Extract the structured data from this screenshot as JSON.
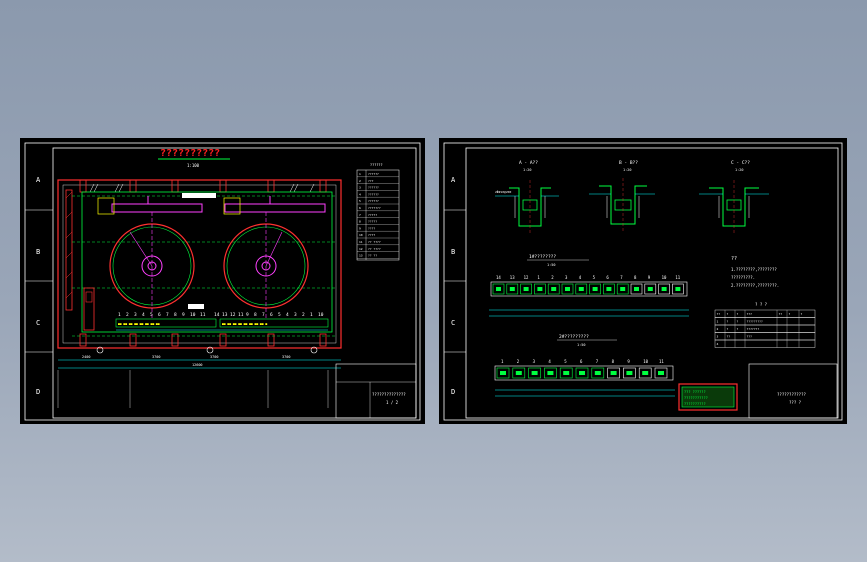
{
  "colors": {
    "background_top": "#8b99ad",
    "sheet": "#000000",
    "border": "#ffffff",
    "title": "#ff2020",
    "green": "#00ff40",
    "magenta": "#ff40ff",
    "cyan": "#00ffff",
    "yellow": "#ffff00",
    "red": "#ff3030"
  },
  "left_sheet": {
    "row_labels": [
      "A",
      "B",
      "C",
      "D"
    ],
    "main_title": "??????????",
    "subtitle": "1:100",
    "legend_title": "??????",
    "legend_rows": [
      {
        "no": "1",
        "name": "??????"
      },
      {
        "no": "2",
        "name": "???"
      },
      {
        "no": "3",
        "name": "??????"
      },
      {
        "no": "4",
        "name": "??????"
      },
      {
        "no": "5",
        "name": "??????"
      },
      {
        "no": "6",
        "name": "???????"
      },
      {
        "no": "7",
        "name": "?????"
      },
      {
        "no": "8",
        "name": "?????"
      },
      {
        "no": "9",
        "name": "????"
      },
      {
        "no": "10",
        "name": "????"
      },
      {
        "no": "11",
        "name": "?? ????"
      },
      {
        "no": "12",
        "name": "?? ????"
      },
      {
        "no": "13",
        "name": "?? ??"
      }
    ],
    "bay_numbers_a": [
      "1",
      "2",
      "3",
      "4",
      "5",
      "6",
      "7",
      "8",
      "9",
      "10",
      "11"
    ],
    "bay_numbers_b": [
      "14",
      "13",
      "12",
      "11",
      "9",
      "8",
      "7",
      "6",
      "5",
      "4",
      "3",
      "2",
      "1",
      "10"
    ],
    "dims": [
      "2400",
      "3700",
      "3700",
      "3700",
      "12600"
    ],
    "title_block": "??????????????",
    "scale": "1 / 2"
  },
  "right_sheet": {
    "row_labels": [
      "A",
      "B",
      "C",
      "D"
    ],
    "section_titles": [
      "A - A??",
      "B - B??",
      "C - C??"
    ],
    "section_scales": [
      "1:20",
      "1:20",
      "1:20"
    ],
    "plan1_title": "1#????????",
    "plan1_scale": "1:50",
    "plan1_numbers": [
      "14",
      "13",
      "12",
      "1",
      "2",
      "3",
      "4",
      "5",
      "6",
      "7",
      "8",
      "9",
      "10",
      "11"
    ],
    "plan2_title": "2#?????????",
    "plan2_scale": "1:50",
    "plan2_numbers": [
      "1",
      "2",
      "3",
      "4",
      "5",
      "6",
      "7",
      "8",
      "9",
      "10",
      "11"
    ],
    "notes_title": "??",
    "notes": [
      "1.????????,????????",
      "  ?????????.",
      "2.????????,????????."
    ],
    "table_title": "? ? ?",
    "table_rows": [
      [
        "??",
        "?",
        "?",
        "???",
        "??",
        "?",
        "?"
      ],
      [
        "1",
        "?",
        "?",
        "?????????",
        "",
        "",
        ""
      ],
      [
        "2",
        "?",
        "?",
        "???????",
        "",
        "",
        ""
      ],
      [
        "3",
        "??",
        "",
        "???",
        "",
        "",
        ""
      ],
      [
        "4",
        "",
        "",
        "",
        "",
        "",
        ""
      ]
    ],
    "stamp_lines": [
      "??? ??????",
      "???????????",
      "??????????"
    ],
    "title_block": "????????????",
    "scale": "??? ?"
  }
}
